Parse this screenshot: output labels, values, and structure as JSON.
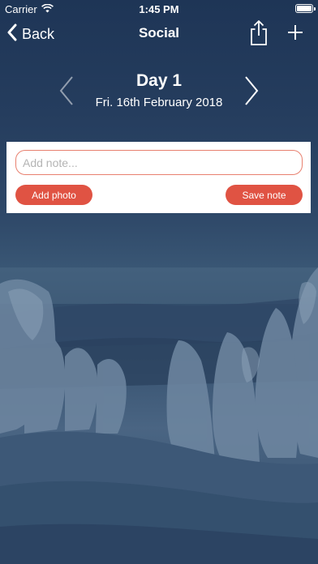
{
  "status_bar": {
    "carrier": "Carrier",
    "time": "1:45 PM"
  },
  "nav": {
    "back_label": "Back",
    "title": "Social"
  },
  "day": {
    "title": "Day 1",
    "date": "Fri. 16th February 2018"
  },
  "note": {
    "placeholder": "Add note...",
    "value": "",
    "add_photo_label": "Add photo",
    "save_label": "Save note"
  },
  "colors": {
    "accent": "#e05343",
    "input_border": "#e8806f",
    "background": "#2a4262"
  },
  "icons": {
    "wifi": "wifi-icon",
    "battery": "battery-icon",
    "back": "chevron-left-icon",
    "share": "share-icon",
    "add": "plus-icon",
    "prev": "chevron-left-icon",
    "next": "chevron-right-icon"
  }
}
